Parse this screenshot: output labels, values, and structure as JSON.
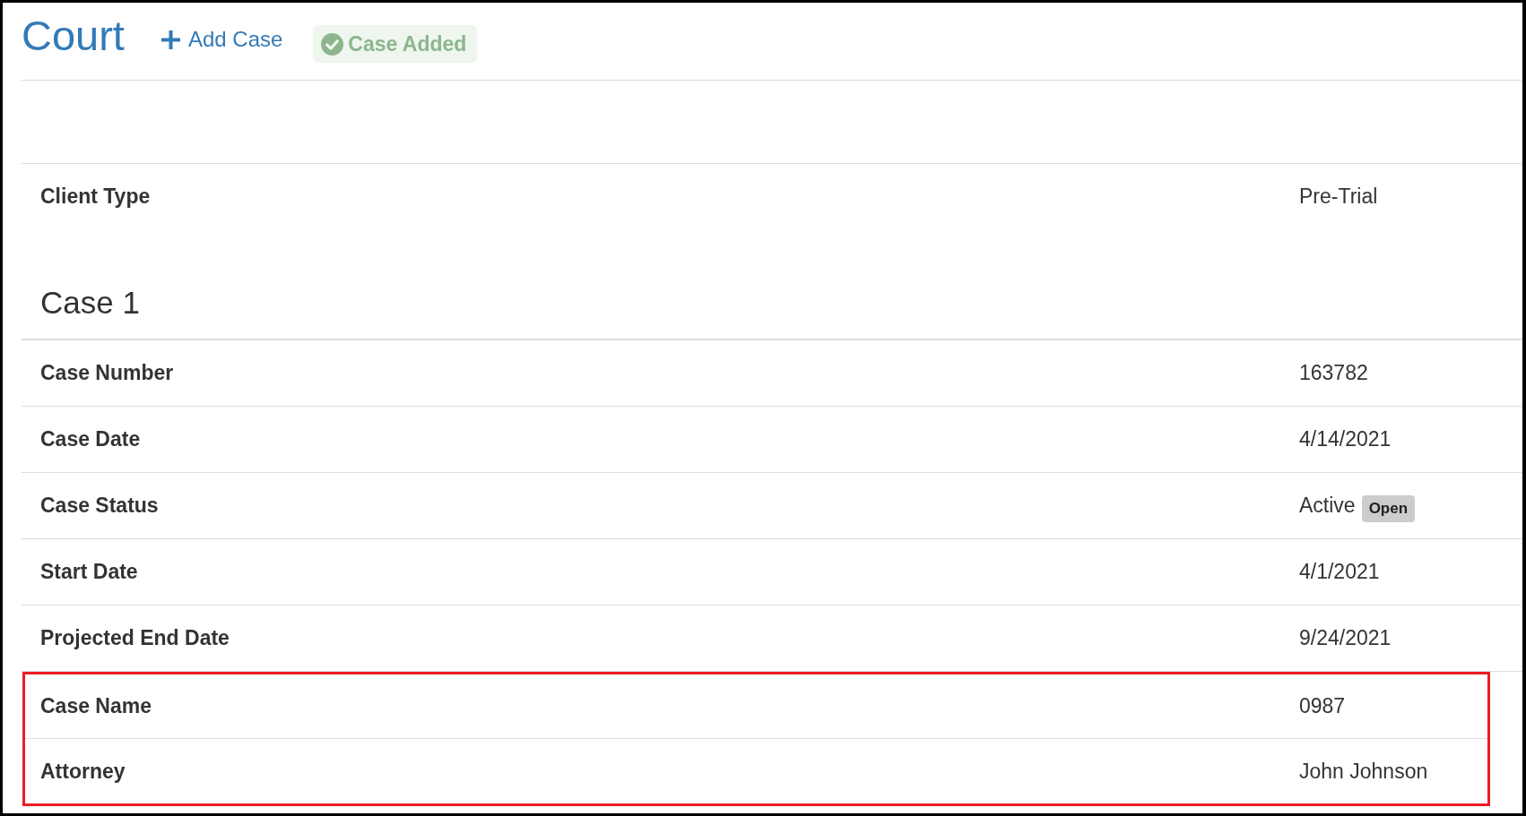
{
  "header": {
    "title": "Court",
    "add_button": {
      "label": "Add Case"
    },
    "notification": {
      "label": "Case Added"
    }
  },
  "client_fields": [
    {
      "label": "Client Type",
      "value": "Pre-Trial"
    }
  ],
  "cases": [
    {
      "title": "Case 1",
      "fields": [
        {
          "label": "Case Number",
          "value": "163782",
          "highlighted": false
        },
        {
          "label": "Case Date",
          "value": "4/14/2021",
          "highlighted": false
        },
        {
          "label": "Case Status",
          "value": "Active",
          "badge": "Open",
          "highlighted": false
        },
        {
          "label": "Start Date",
          "value": "4/1/2021",
          "highlighted": false
        },
        {
          "label": "Projected End Date",
          "value": "9/24/2021",
          "highlighted": false
        },
        {
          "label": "Case Name",
          "value": "0987",
          "highlighted": true
        },
        {
          "label": "Attorney",
          "value": "John Johnson",
          "highlighted": true
        }
      ]
    }
  ]
}
